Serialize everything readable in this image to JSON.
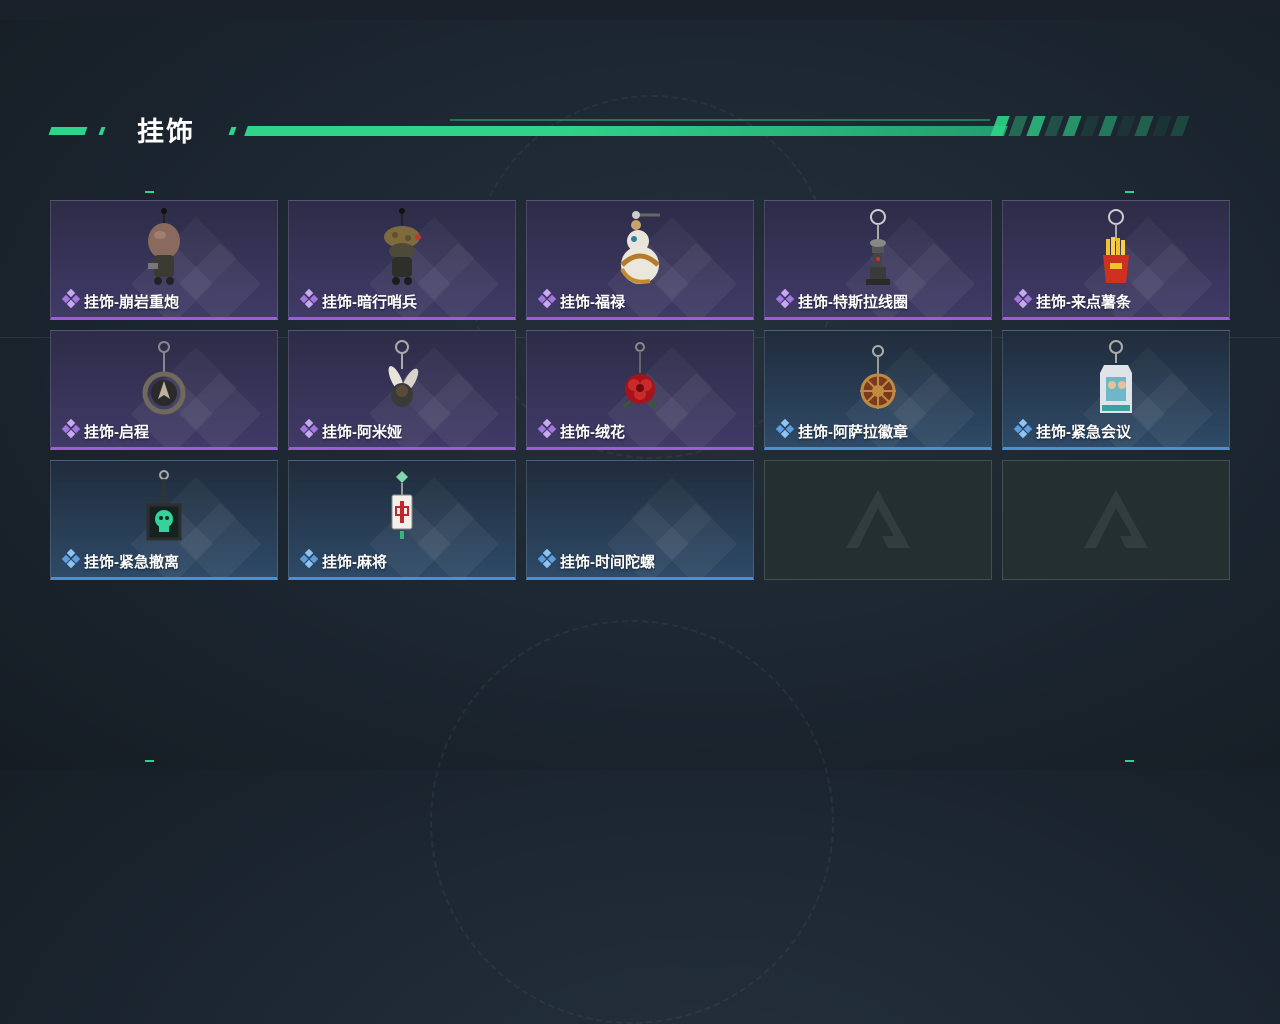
{
  "section": {
    "title": "挂饰"
  },
  "colors": {
    "accent_green": "#2fd48a",
    "purple_rarity": "#9a5ed8",
    "blue_rarity": "#4a90d4",
    "purple_card_bg": "#403a67",
    "blue_card_bg": "#2e4a67",
    "empty_slot_bg": "#23302f"
  },
  "items": [
    {
      "label": "挂饰-崩岩重炮",
      "rarity": "purple",
      "icon": "mushroom-soldier-charm-icon"
    },
    {
      "label": "挂饰-暗行哨兵",
      "rarity": "purple",
      "icon": "camo-soldier-charm-icon"
    },
    {
      "label": "挂饰-福禄",
      "rarity": "purple",
      "icon": "gourd-charm-icon"
    },
    {
      "label": "挂饰-特斯拉线圈",
      "rarity": "purple",
      "icon": "tesla-coil-charm-icon"
    },
    {
      "label": "挂饰-来点薯条",
      "rarity": "purple",
      "icon": "fries-charm-icon"
    },
    {
      "label": "挂饰-启程",
      "rarity": "purple",
      "icon": "compass-ring-charm-icon"
    },
    {
      "label": "挂饰-阿米娅",
      "rarity": "purple",
      "icon": "rabbit-charm-icon"
    },
    {
      "label": "挂饰-绒花",
      "rarity": "purple",
      "icon": "red-flower-charm-icon"
    },
    {
      "label": "挂饰-阿萨拉徽章",
      "rarity": "blue",
      "icon": "ship-wheel-badge-icon"
    },
    {
      "label": "挂饰-紧急会议",
      "rarity": "blue",
      "icon": "acrylic-stand-charm-icon"
    },
    {
      "label": "挂饰-紧急撤离",
      "rarity": "blue",
      "icon": "green-skull-cube-charm-icon"
    },
    {
      "label": "挂饰-麻将",
      "rarity": "blue",
      "icon": "mahjong-tile-charm-icon"
    },
    {
      "label": "挂饰-时间陀螺",
      "rarity": "blue",
      "icon": "spinning-top-charm-icon"
    },
    {
      "label": "",
      "rarity": "empty",
      "icon": "empty-slot-logo-icon"
    },
    {
      "label": "",
      "rarity": "empty",
      "icon": "empty-slot-logo-icon"
    }
  ]
}
